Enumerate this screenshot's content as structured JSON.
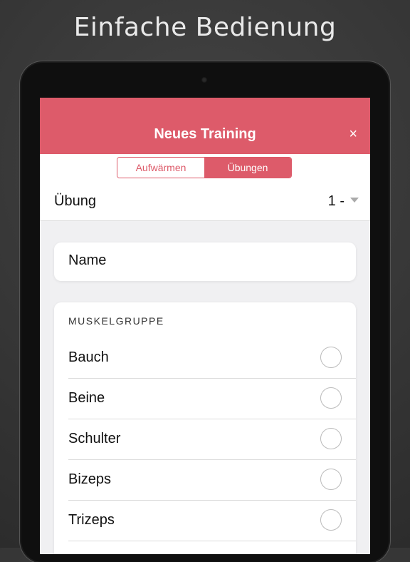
{
  "headline": "Einfache Bedienung",
  "nav": {
    "title": "Neues Training",
    "close": "×"
  },
  "segments": [
    {
      "label": "Aufwärmen",
      "active": false
    },
    {
      "label": "Übungen",
      "active": true
    }
  ],
  "exercise": {
    "label": "Übung",
    "value": "1 -"
  },
  "name_field": {
    "placeholder": "Name"
  },
  "muscle_group": {
    "header": "MUSKELGRUPPE",
    "items": [
      "Bauch",
      "Beine",
      "Schulter",
      "Bizeps",
      "Trizeps"
    ]
  },
  "colors": {
    "accent": "#dd5b6a",
    "background": "#f0f0f2"
  }
}
